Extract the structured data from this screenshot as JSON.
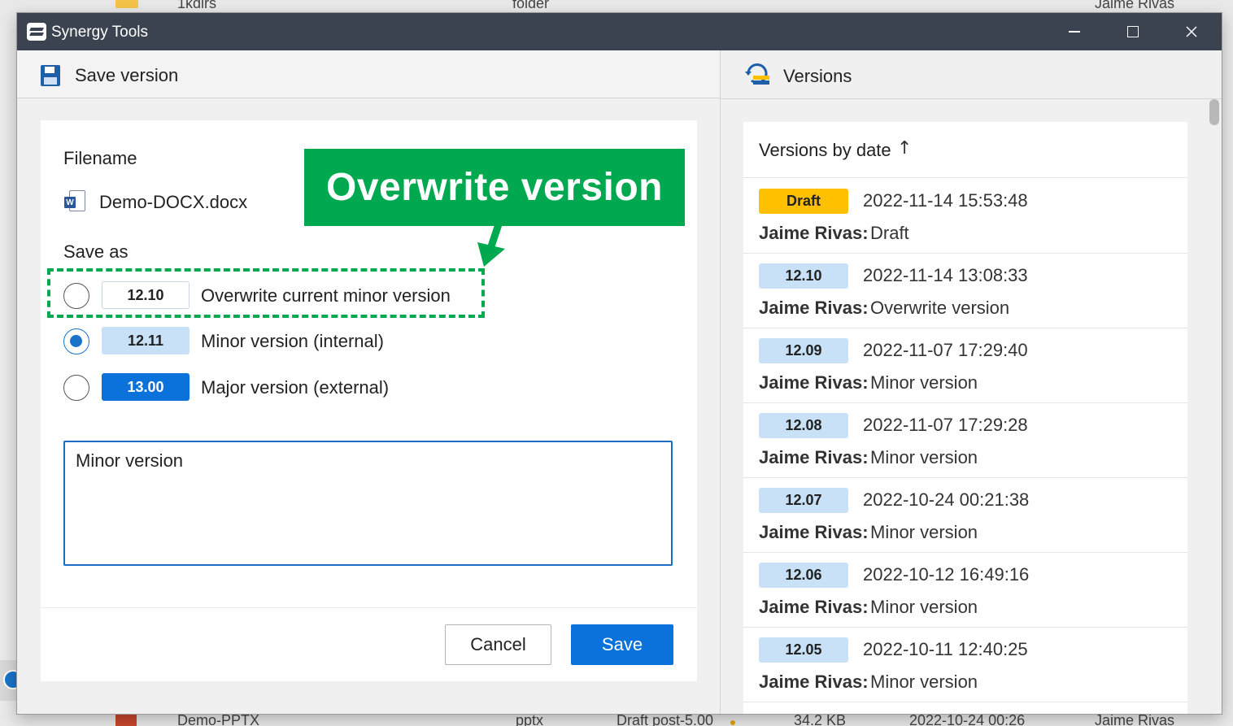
{
  "background": {
    "top_row": {
      "name": "1kdirs",
      "type": "folder",
      "owner": "Jaime Rivas"
    },
    "bottom_row": {
      "name": "Demo-PPTX",
      "type": "pptx",
      "status": "Draft post-5.00",
      "size": "34.2 KB",
      "date": "2022-10-24 00:26",
      "owner": "Jaime Rivas"
    }
  },
  "window": {
    "title": "Synergy Tools"
  },
  "save_panel": {
    "title": "Save version",
    "filename_label": "Filename",
    "filename": "Demo-DOCX.docx",
    "save_as_label": "Save as",
    "options": [
      {
        "version": "12.10",
        "label": "Overwrite current minor version",
        "checked": false
      },
      {
        "version": "12.11",
        "label": "Minor version (internal)",
        "checked": true
      },
      {
        "version": "13.00",
        "label": "Major version (external)",
        "checked": false
      }
    ],
    "comment": "Minor version",
    "cancel_label": "Cancel",
    "save_label": "Save"
  },
  "annotation": {
    "text": "Overwrite version",
    "color": "#00a94f"
  },
  "versions_panel": {
    "title": "Versions",
    "list_title": "Versions by date",
    "sort_icon": "arrow-up-icon",
    "items": [
      {
        "version": "Draft",
        "date": "2022-11-14 15:53:48",
        "author": "Jaime Rivas:",
        "comment": "Draft"
      },
      {
        "version": "12.10",
        "date": "2022-11-14 13:08:33",
        "author": "Jaime Rivas:",
        "comment": "Overwrite version"
      },
      {
        "version": "12.09",
        "date": "2022-11-07 17:29:40",
        "author": "Jaime Rivas:",
        "comment": "Minor version"
      },
      {
        "version": "12.08",
        "date": "2022-11-07 17:29:28",
        "author": "Jaime Rivas:",
        "comment": "Minor version"
      },
      {
        "version": "12.07",
        "date": "2022-10-24 00:21:38",
        "author": "Jaime Rivas:",
        "comment": "Minor version"
      },
      {
        "version": "12.06",
        "date": "2022-10-12 16:49:16",
        "author": "Jaime Rivas:",
        "comment": "Minor version"
      },
      {
        "version": "12.05",
        "date": "2022-10-11 12:40:25",
        "author": "Jaime Rivas:",
        "comment": "Minor version"
      }
    ]
  },
  "colors": {
    "accent": "#0b72db",
    "draft": "#ffc000",
    "minor_chip": "#c8e1f6",
    "titlebar": "#3c4350"
  }
}
